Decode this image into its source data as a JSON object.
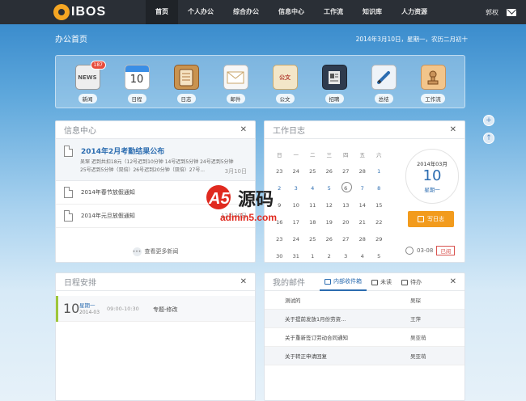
{
  "brand": {
    "logo_text": "IBOS"
  },
  "nav": {
    "items": [
      {
        "label": "首页",
        "active": true
      },
      {
        "label": "个人办公",
        "active": false
      },
      {
        "label": "综合办公",
        "active": false
      },
      {
        "label": "信息中心",
        "active": false
      },
      {
        "label": "工作流",
        "active": false
      },
      {
        "label": "知识库",
        "active": false
      },
      {
        "label": "人力资源",
        "active": false
      }
    ],
    "user": "郭权"
  },
  "page": {
    "title": "办公首页",
    "date": "2014年3月10日，星期一，农历二月初十"
  },
  "apps": [
    {
      "label": "新闻",
      "icon": "news-icon",
      "badge": "187",
      "glyph": "NEWS"
    },
    {
      "label": "日程",
      "icon": "calendar-icon",
      "glyph": "10"
    },
    {
      "label": "日志",
      "icon": "diary-icon",
      "glyph": ""
    },
    {
      "label": "邮件",
      "icon": "mail-icon",
      "glyph": ""
    },
    {
      "label": "公文",
      "icon": "document-icon",
      "glyph": "公文"
    },
    {
      "label": "招聘",
      "icon": "recruit-icon",
      "glyph": ""
    },
    {
      "label": "总结",
      "icon": "summary-icon",
      "glyph": ""
    },
    {
      "label": "工作流",
      "icon": "workflow-icon",
      "glyph": ""
    }
  ],
  "info_center": {
    "title": "信息中心",
    "featured": {
      "title": "2014年2月考勤结果公布",
      "date": "3月10日",
      "detail": "吴琛 迟到共扣18元（12号迟到10分钟 14号迟到5分钟 24号迟到5分钟 25号迟到5分钟（双倍）26号迟到20分钟（双倍）27号..."
    },
    "items": [
      {
        "title": "2014年春节放假通知",
        "date": ""
      },
      {
        "title": "2014年元旦放假通知",
        "date": "12月30日"
      }
    ],
    "more": "查看更多新闻"
  },
  "work_log": {
    "title": "工作日志",
    "weekdays": [
      "日",
      "一",
      "二",
      "三",
      "四",
      "五",
      "六"
    ],
    "weeks": [
      [
        "23",
        "24",
        "25",
        "26",
        "27",
        "28",
        "1"
      ],
      [
        "2",
        "3",
        "4",
        "5",
        "6",
        "7",
        "8"
      ],
      [
        "9",
        "10",
        "11",
        "12",
        "13",
        "14",
        "15"
      ],
      [
        "16",
        "17",
        "18",
        "19",
        "20",
        "21",
        "22"
      ],
      [
        "23",
        "24",
        "25",
        "26",
        "27",
        "28",
        "29"
      ],
      [
        "30",
        "31",
        "1",
        "2",
        "3",
        "4",
        "5"
      ]
    ],
    "date_box": {
      "year_month": "2014年03月",
      "day": "10",
      "weekday": "星期一"
    },
    "write_button": "写日志",
    "footer_date": "03-08",
    "stamp": "已阅"
  },
  "schedule": {
    "title": "日程安排",
    "entries": [
      {
        "day": "10",
        "weekday": "星期一",
        "year_month": "2014-03",
        "time": "09:00-10:30",
        "title": "专题-修改"
      }
    ]
  },
  "mail": {
    "title": "我的邮件",
    "tabs": [
      {
        "label": "内部收件箱",
        "active": true
      },
      {
        "label": "未读",
        "active": false
      },
      {
        "label": "待办",
        "active": false
      }
    ],
    "rows": [
      {
        "subject": "测试的",
        "sender": "吴琛"
      },
      {
        "subject": "关于提前发放1月份劳资...",
        "sender": "王萍"
      },
      {
        "subject": "关于重新签订劳动合同通知",
        "sender": "吴亚萌"
      },
      {
        "subject": "关于转正申请回复",
        "sender": "吴亚萌"
      }
    ]
  },
  "watermark": {
    "mark": "A5",
    "cn": "源码",
    "url": "admin5.com"
  },
  "colors": {
    "nav_bg": "#2a2f36",
    "accent": "#2b6cb0",
    "orange": "#f29b1d",
    "green": "#9dc63a"
  }
}
